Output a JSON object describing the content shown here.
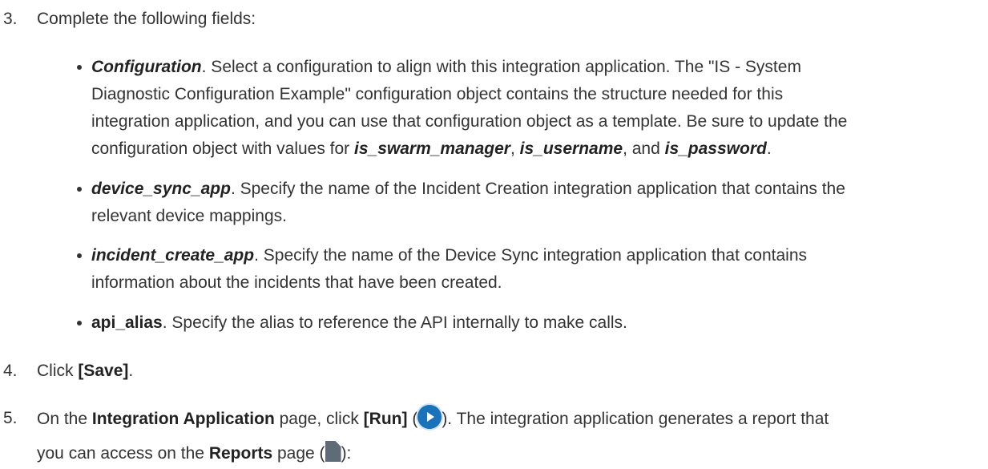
{
  "steps": [
    {
      "num": "3.",
      "text": "Complete the following fields:"
    },
    {
      "num": "4.",
      "pre": "Click ",
      "bold": "[Save]",
      "post": "."
    },
    {
      "num": "5.",
      "t1": "On the ",
      "b1": "Integration Application",
      "t2": " page, click ",
      "b2": "[Run]",
      "t3": " (",
      "t4": "). The integration application generates a report that",
      "t5": "you can access on the ",
      "b3": "Reports",
      "t6": " page (",
      "t7": "):"
    }
  ],
  "fields": [
    {
      "name": "Configuration",
      "lines": [
        ". Select a configuration to align with this integration application. The \"IS - System",
        "Diagnostic Configuration Example\" configuration object contains the structure needed for this",
        "integration application, and you can use that configuration object as a template. Be sure to update the"
      ],
      "l4a": "configuration object with values for ",
      "v1": "is_swarm_manager",
      "sep1": ", ",
      "v2": "is_username",
      "sep2": ", and ",
      "v3": "is_password",
      "end": "."
    },
    {
      "name": "device_sync_app",
      "lines": [
        ". Specify the name of the Incident Creation integration application that contains the",
        "relevant device mappings."
      ]
    },
    {
      "name": "incident_create_app",
      "lines": [
        ". Specify the name of the Device Sync integration application that contains",
        "information about the incidents that have been created."
      ]
    },
    {
      "name": "api_alias",
      "lines": [
        ". Specify the alias to reference the API internally to make calls."
      ]
    }
  ],
  "icons": {
    "run": "play-circle-icon",
    "reports": "document-icon"
  },
  "colors": {
    "run_icon": "#1a73b8",
    "reports_icon": "#5f6b76",
    "text": "#333333"
  }
}
